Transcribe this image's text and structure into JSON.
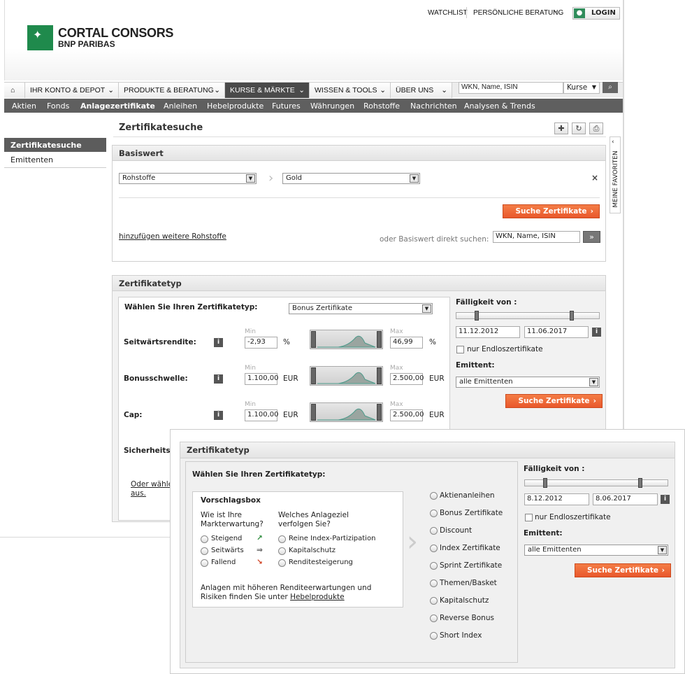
{
  "header": {
    "watchlist": "WATCHLIST",
    "beratung": "PERSÖNLICHE BERATUNG",
    "login": "LOGIN",
    "logo_line1": "CORTAL CONSORS",
    "logo_line2": "BNP PARIBAS"
  },
  "nav": {
    "items": [
      "IHR KONTO & DEPOT",
      "PRODUKTE & BERATUNG",
      "KURSE & MÄRKTE",
      "WISSEN & TOOLS",
      "ÜBER UNS"
    ],
    "search_placeholder": "WKN, Name, ISIN",
    "search_scope": "Kurse"
  },
  "subnav": [
    "Aktien",
    "Fonds",
    "Anlagezertifikate",
    "Anleihen",
    "Hebelprodukte",
    "Futures",
    "Währungen",
    "Rohstoffe",
    "Nachrichten",
    "Analysen & Trends"
  ],
  "sidebar": {
    "items": [
      "Zertifikatesuche",
      "Emittenten"
    ]
  },
  "page": {
    "title": "Zertifikatesuche",
    "favorites_tab": "MEINE FAVORITEN"
  },
  "basiswert": {
    "heading": "Basiswert",
    "category": "Rohstoffe",
    "underlying": "Gold",
    "close": "×",
    "search_button": "Suche Zertifikate",
    "add_link": "hinzufügen weitere Rohstoffe",
    "direct_label": "oder Basiswert direkt suchen:",
    "direct_placeholder": "WKN, Name, ISIN",
    "go": "»"
  },
  "zertifikatetyp": {
    "heading": "Zertifikatetyp",
    "choose_label": "Wählen Sie Ihren Zertifikatetyp:",
    "selected_type": "Bonus Zertifikate",
    "min_label": "Min",
    "max_label": "Max",
    "info": "i",
    "rows": [
      {
        "label": "Seitwärtsrendite:",
        "min": "-2,93",
        "unit": "%",
        "max": "46,99"
      },
      {
        "label": "Bonusschwelle:",
        "min": "1.100,00",
        "unit": "EUR",
        "max": "2.500,00"
      },
      {
        "label": "Cap:",
        "min": "1.100,00",
        "unit": "EUR",
        "max": "2.500,00"
      }
    ],
    "partial_label": "Sicherheits",
    "other_link1": "Oder wähle",
    "other_link2": "aus.",
    "maturity_label": "Fälligkeit von :",
    "date_from": "11.12.2012",
    "date_to": "11.06.2017",
    "endless": "nur Endloszertifikate",
    "issuer_label": "Emittent:",
    "issuer_value": "alle Emittenten",
    "search_button": "Suche Zertifikate"
  },
  "overlay": {
    "heading": "Zertifikatetyp",
    "choose_label": "Wählen Sie Ihren Zertifikatetyp:",
    "box_title": "Vorschlagsbox",
    "q1": "Wie ist Ihre Markterwartung?",
    "q2": "Welches Anlageziel verfolgen Sie?",
    "expectations": [
      "Steigend",
      "Seitwärts",
      "Fallend"
    ],
    "goals": [
      "Reine Index-Partizipation",
      "Kapitalschutz",
      "Renditesteigerung"
    ],
    "note": "Anlagen mit höheren Renditeerwartungen und Risiken finden Sie unter",
    "note_link": "Hebelprodukte",
    "types": [
      "Aktienanleihen",
      "Bonus Zertifikate",
      "Discount",
      "Index Zertifikate",
      "Sprint Zertifikate",
      "Themen/Basket",
      "Kapitalschutz",
      "Reverse Bonus",
      "Short Index"
    ],
    "maturity_label": "Fälligkeit von :",
    "date_from": "8.12.2012",
    "date_to": "8.06.2017",
    "endless": "nur Endloszertifikate",
    "issuer_label": "Emittent:",
    "issuer_value": "alle Emittenten",
    "search_button": "Suche Zertifikate",
    "info": "i"
  },
  "colors": {
    "brand_green": "#1f8a4c",
    "accent_orange": "#ee6a39",
    "nav_dark": "#4a4a4a"
  }
}
